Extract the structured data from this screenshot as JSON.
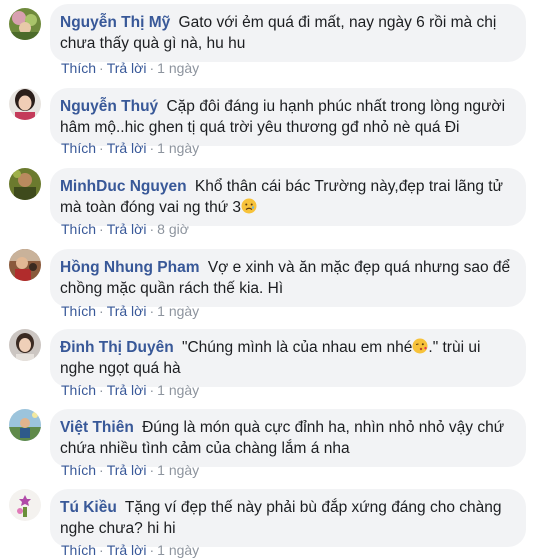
{
  "comments": [
    {
      "author": "Nguyễn Thị Mỹ",
      "text": "Gato với ẻm quá đi mất, nay ngày 6 rồi mà chị chưa thấy quà gì nà, hu hu",
      "like": "Thích",
      "reply": "Trả lời",
      "time": "1 ngày"
    },
    {
      "author": "Nguyễn Thuý",
      "text": "Cặp đôi đáng iu hạnh phúc nhất trong lòng người hâm mộ..hic ghen tị quá trời yêu thương gđ nhỏ nè quá Đi",
      "like": "Thích",
      "reply": "Trả lời",
      "time": "1 ngày"
    },
    {
      "author": "MinhDuc Nguyen",
      "text": "Khổ thân cái bác Trường này,đẹp trai lãng tử mà toàn đóng vai ng thứ 3",
      "like": "Thích",
      "reply": "Trả lời",
      "time": "8 giờ",
      "emoji": "sad-face"
    },
    {
      "author": "Hồng Nhung Pham",
      "text": "Vợ e xinh và ăn mặc đẹp quá nhưng sao để chồng mặc quần rách thế kia. Hì",
      "like": "Thích",
      "reply": "Trả lời",
      "time": "1 ngày"
    },
    {
      "author": "Đinh Thị Duyên",
      "text_before": "\"Chúng mình là của nhau em nhé",
      "text_after": ".\" trùi ui nghe ngọt quá hà",
      "like": "Thích",
      "reply": "Trả lời",
      "time": "1 ngày",
      "emoji": "kissing-face"
    },
    {
      "author": "Việt Thiên",
      "text": "Đúng là món quà cực đỉnh ha, nhìn nhỏ nhỏ vậy chứ chứa nhiều tình cảm của chàng lắm á nha",
      "like": "Thích",
      "reply": "Trả lời",
      "time": "1 ngày"
    },
    {
      "author": "Tú Kiều",
      "text": "Tặng ví đẹp thế này phải bù đắp xứng đáng cho chàng nghe chưa? hi hi",
      "like": "Thích",
      "reply": "Trả lời",
      "time": "1 ngày"
    }
  ],
  "separator": "·"
}
